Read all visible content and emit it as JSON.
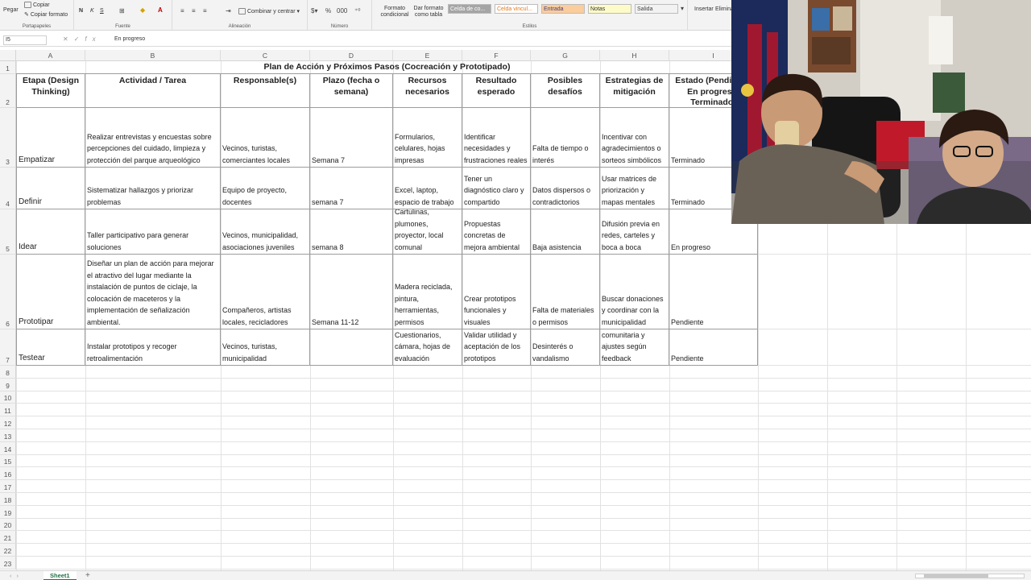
{
  "ribbon": {
    "clipboard": {
      "paste": "Pegar",
      "copy": "Copiar",
      "copy_format": "Copiar formato",
      "group": "Portapapeles"
    },
    "font": {
      "bold": "N",
      "italic": "K",
      "underline": "S",
      "group": "Fuente"
    },
    "alignment": {
      "merge": "Combinar y centrar",
      "group": "Alineación"
    },
    "number": {
      "group": "Número"
    },
    "styles": {
      "conditional": "Formato condicional",
      "as_table": "Dar formato como tabla",
      "group": "Estilos",
      "cells": [
        {
          "label": "Celda de co...",
          "bg": "#a5a5a5",
          "fg": "#ffffff"
        },
        {
          "label": "Celda vincul...",
          "bg": "#ffffff",
          "fg": "#e57a1c"
        },
        {
          "label": "Entrada",
          "bg": "#fbcc9c",
          "fg": "#3f3f76"
        },
        {
          "label": "Notas",
          "bg": "#fdfbc8",
          "fg": "#333333"
        },
        {
          "label": "Salida",
          "bg": "#f2f2f2",
          "fg": "#3f3f3f"
        }
      ]
    },
    "cells_group": {
      "insert": "Insertar",
      "delete": "Elimina"
    }
  },
  "formula_bar": {
    "name_box": "I5",
    "value": "En progreso"
  },
  "columns": [
    "A",
    "B",
    "C",
    "D",
    "E",
    "F",
    "G",
    "H",
    "I"
  ],
  "rows": [
    "1",
    "2",
    "3",
    "4",
    "5",
    "6",
    "7",
    "8",
    "9",
    "10",
    "11",
    "12",
    "13",
    "14",
    "15",
    "16",
    "17",
    "18",
    "19",
    "20",
    "21",
    "22",
    "23"
  ],
  "table": {
    "title": "Plan de Acción y Próximos Pasos (Cocreación y Prototipado)",
    "headers": [
      "Etapa (Design Thinking)",
      "Actividad / Tarea",
      "Responsable(s)",
      "Plazo (fecha o semana)",
      "Recursos necesarios",
      "Resultado esperado",
      "Posibles desafíos",
      "Estrategias de mitigación",
      "Estado (Pendiente, En progreso, Terminado)"
    ],
    "rows": [
      [
        "Empatizar",
        "Realizar entrevistas y encuestas sobre percepciones del cuidado, limpieza y protección del parque arqueológico",
        "Vecinos, turistas, comerciantes locales",
        "Semana 7",
        "Formularios, celulares, hojas impresas",
        "Identificar necesidades y frustraciones reales",
        "Falta de tiempo o interés",
        "Incentivar con agradecimientos o sorteos simbólicos",
        "Terminado"
      ],
      [
        "Definir",
        "Sistematizar hallazgos y priorizar problemas",
        "Equipo de proyecto, docentes",
        "semana 7",
        "Excel, laptop, espacio de trabajo",
        "Tener un diagnóstico claro y compartido",
        "Datos dispersos o contradictorios",
        "Usar matrices de priorización y mapas mentales",
        "Terminado"
      ],
      [
        "Idear",
        "Taller participativo para generar soluciones",
        "Vecinos, municipalidad, asociaciones juveniles",
        "semana 8",
        "Cartulinas, plumones, proyector, local comunal",
        "Propuestas concretas de mejora ambiental",
        "Baja asistencia",
        "Difusión previa en redes, carteles y boca a boca",
        "En progreso"
      ],
      [
        "Prototipar",
        "Diseñar un plan de acción para mejorar el atractivo del lugar mediante la instalación de puntos de ciclaje, la colocación de maceteros y la implementación de señalización ambiental.",
        "Compañeros, artistas locales, recicladores",
        "Semana 11-12",
        "Madera reciclada, pintura, herramientas, permisos",
        "Crear prototipos funcionales y visuales",
        "Falta de materiales o permisos",
        "Buscar donaciones y coordinar con la municipalidad",
        "Pendiente"
      ],
      [
        "Testear",
        "Instalar prototipos y recoger retroalimentación",
        "Vecinos, turistas, municipalidad",
        "",
        "Cuestionarios, cámara, hojas de evaluación",
        "Validar utilidad y aceptación de los prototipos",
        "Desinterés o vandalismo",
        "comunitaria y ajustes según feedback",
        "Pendiente"
      ]
    ]
  },
  "sheet_tabs": {
    "active": "Sheet1",
    "add": "+"
  }
}
